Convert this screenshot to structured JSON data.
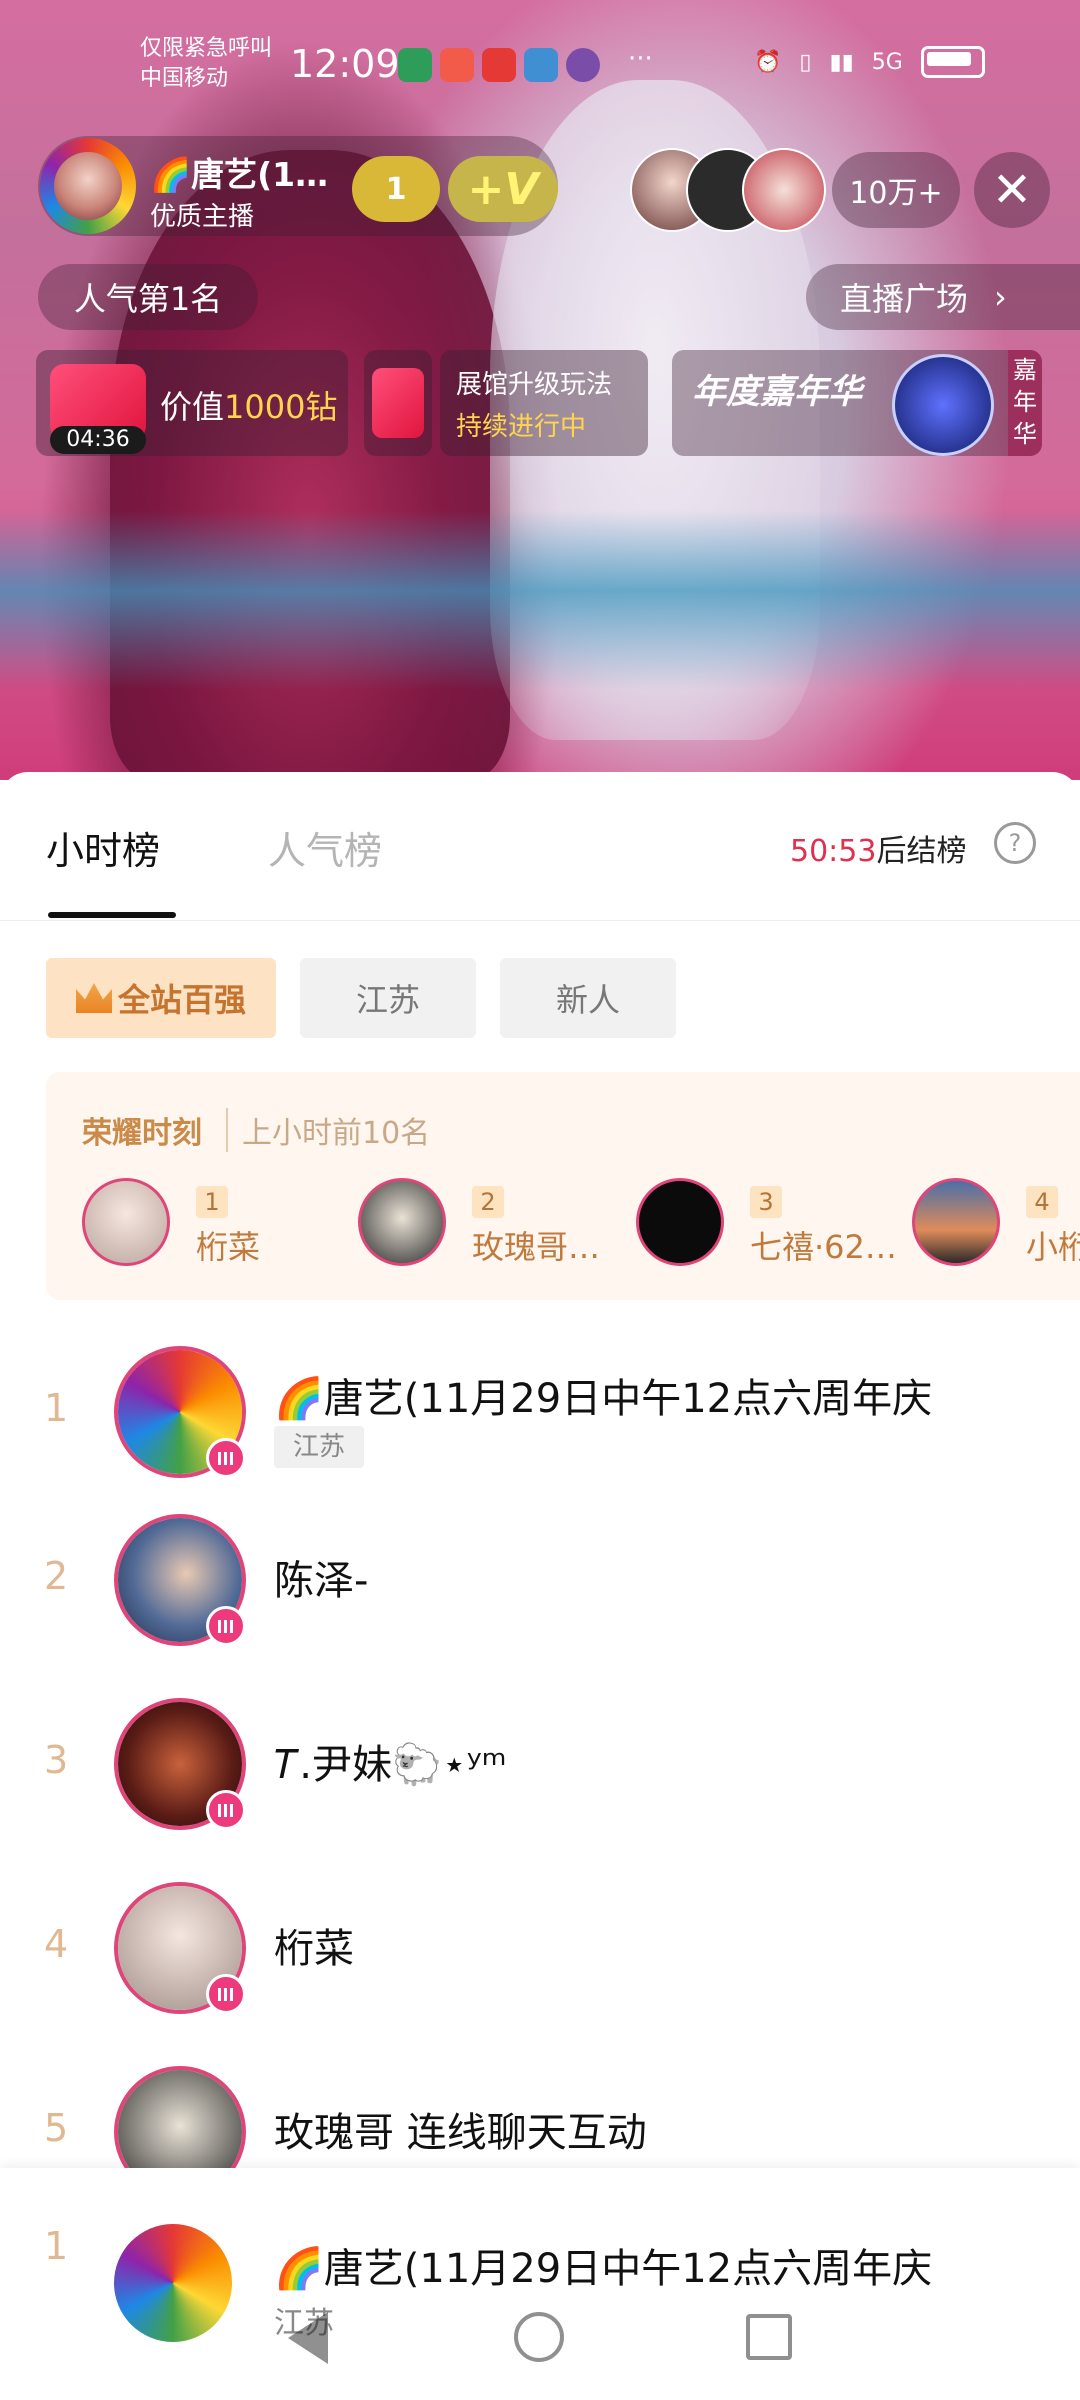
{
  "status_bar": {
    "carrier_line1": "仅限紧急呼叫",
    "carrier_line2": "中国移动",
    "time": "12:09",
    "more": "···",
    "network": "5G"
  },
  "live": {
    "host_name": "🌈唐艺(1…",
    "host_badge": "优质主播",
    "heart_count": "1",
    "v_label": "+V",
    "viewer_count": "10万+",
    "close_icon": "close-icon",
    "popularity_rank": "人气第1名",
    "plaza_label": "直播广场",
    "gift_banner": {
      "prefix": "价值",
      "value": "1000钻",
      "timer": "04:36"
    },
    "expo_banner": {
      "line1": "展馆升级玩法",
      "line2": "持续进行中"
    },
    "carnival_banner": {
      "title": "年度嘉年华",
      "side": [
        "嘉",
        "年",
        "华"
      ]
    }
  },
  "panel": {
    "tabs": [
      {
        "label": "小时榜",
        "active": true
      },
      {
        "label": "人气榜",
        "active": false
      }
    ],
    "countdown_value": "50:53",
    "countdown_suffix": "后结榜",
    "help_icon": "question-circle-icon",
    "filters": [
      {
        "label": "全站百强",
        "active": true
      },
      {
        "label": "江苏",
        "active": false
      },
      {
        "label": "新人",
        "active": false
      }
    ],
    "honor": {
      "title": "荣耀时刻",
      "subtitle": "上小时前10名",
      "items": [
        {
          "rank": "1",
          "name": "桁菜"
        },
        {
          "rank": "2",
          "name": "玫瑰哥…"
        },
        {
          "rank": "3",
          "name": "七禧·62…"
        },
        {
          "rank": "4",
          "name": "小桁"
        }
      ]
    },
    "rows": [
      {
        "rank": "1",
        "name": "🌈唐艺(11月29日中午12点六周年庆",
        "tag": "江苏"
      },
      {
        "rank": "2",
        "name": "陈泽-",
        "tag": ""
      },
      {
        "rank": "3",
        "name": "𝑇.尹妹🐑⋆ʸᵐ",
        "tag": ""
      },
      {
        "rank": "4",
        "name": "桁菜",
        "tag": ""
      },
      {
        "rank": "5",
        "name": "玫瑰哥 连线聊天互动",
        "tag": ""
      }
    ],
    "my_row": {
      "rank": "1",
      "name": "🌈唐艺(11月29日中午12点六周年庆",
      "tag": "江苏"
    }
  },
  "colors": {
    "accent_pink": "#e0457a",
    "countdown_red": "#e0304e",
    "rank_gold": "#e0b892",
    "honor_bg": "#fff7ef"
  }
}
